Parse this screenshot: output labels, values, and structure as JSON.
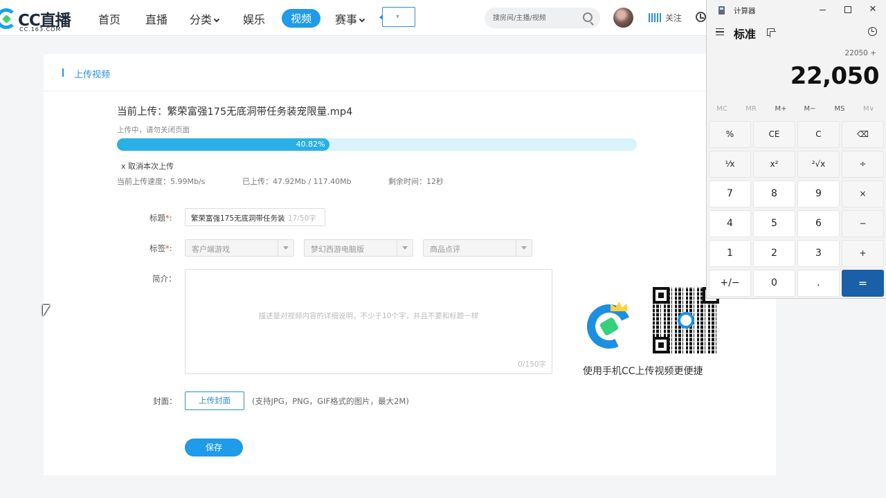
{
  "header": {
    "logo_text": "CC直播",
    "logo_sub": "CC.163.COM",
    "nav": [
      "首页",
      "直播",
      "分类",
      "娱乐",
      "视频",
      "赛事"
    ],
    "search_placeholder": "搜房间/主播/视频",
    "follow_label": "关注",
    "accent_color": "#1e9be9"
  },
  "panel": {
    "title": "上传视频",
    "current_upload": "当前上传：繁荣富强175无底洞带任务装宠限量.mp4",
    "uploading_hint": "上传中，请勿关闭页面",
    "progress_percent": 40.82,
    "progress_label": "40.82%",
    "cancel_label": "x 取消本次上传",
    "speed": "当前上传速度：5.99Mb/s",
    "uploaded": "已上传：47.92Mb / 117.40Mb",
    "remaining": "剩余时间：12秒",
    "title_label": "标题",
    "title_value": "繁荣富强175无底洞带任务装",
    "title_count": "17/50字",
    "tag_label": "标签",
    "tags": [
      "客户端游戏",
      "梦幻西游电脑版",
      "商品点评"
    ],
    "intro_label": "简介：",
    "intro_placeholder": "描述是对视频内容的详细说明，不少于10个字，并且不要和标题一样",
    "intro_count": "0/150字",
    "cover_label": "封面：",
    "cover_button": "上传封面",
    "cover_hint": "(支持JPG，PNG，GIF格式的图片，最大2M)",
    "save_button": "保存",
    "app_hint": "使用手机CC上传视频更便捷"
  },
  "calculator": {
    "window_title": "计算器",
    "mode": "标准",
    "expression": "22050 +",
    "display": "22,050",
    "memory": [
      "MC",
      "MR",
      "M+",
      "M−",
      "MS",
      "M∨"
    ],
    "keys": [
      [
        "%",
        "CE",
        "C",
        "⌫"
      ],
      [
        "¹⁄x",
        "x²",
        "²√x",
        "÷"
      ],
      [
        "7",
        "8",
        "9",
        "×"
      ],
      [
        "4",
        "5",
        "6",
        "−"
      ],
      [
        "1",
        "2",
        "3",
        "+"
      ],
      [
        "+/−",
        "0",
        ".",
        "="
      ]
    ],
    "equals_color": "#1a5fa8"
  }
}
